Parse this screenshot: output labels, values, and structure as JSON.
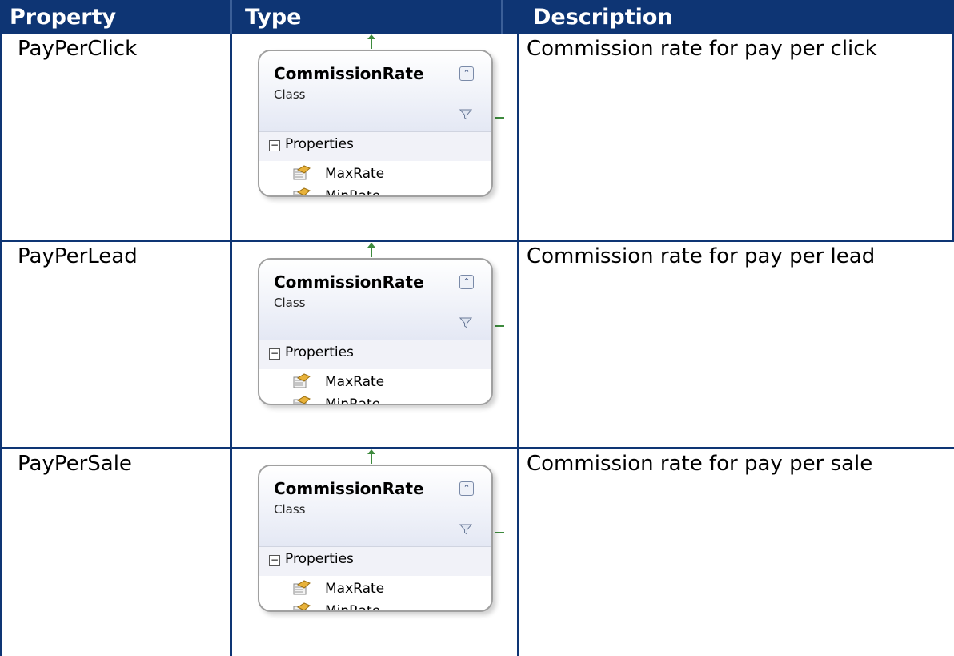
{
  "header": {
    "col_property": "Property",
    "col_type": "Type",
    "col_description": "Description"
  },
  "rows": [
    {
      "property": "PayPerClick",
      "description": "Commission rate for pay per click",
      "class_box": {
        "name": "CommissionRate",
        "kind": "Class",
        "section": "Properties",
        "properties": [
          "MaxRate",
          "MinRate"
        ]
      }
    },
    {
      "property": "PayPerLead",
      "description": "Commission rate for pay per lead",
      "class_box": {
        "name": "CommissionRate",
        "kind": "Class",
        "section": "Properties",
        "properties": [
          "MaxRate",
          "MinRate"
        ]
      }
    },
    {
      "property": "PayPerSale",
      "description": "Commission rate for pay per sale",
      "class_box": {
        "name": "CommissionRate",
        "kind": "Class",
        "section": "Properties",
        "properties": [
          "MaxRate",
          "MinRate"
        ]
      }
    }
  ],
  "colors": {
    "header_bg": "#0e3574",
    "header_text": "#ffffff",
    "connector": "#3d8a3d"
  },
  "icons": {
    "collapse": "double-chevron-up-icon",
    "filter": "filter-icon",
    "section_toggle": "minus-box-icon",
    "property": "property-icon"
  }
}
